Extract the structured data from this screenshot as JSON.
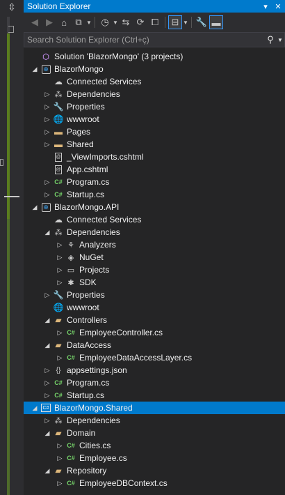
{
  "window": {
    "title": "Solution Explorer",
    "buttons": [
      "▾",
      "✕"
    ]
  },
  "toolbar": {
    "items": [
      {
        "icon": "back-icon",
        "glyph": "◀"
      },
      {
        "icon": "forward-icon",
        "glyph": "▶"
      },
      {
        "icon": "home-icon",
        "glyph": "⌂"
      },
      {
        "icon": "switch-views-icon",
        "glyph": "⧉"
      },
      {
        "icon": "pending-changes-icon",
        "glyph": "◷"
      },
      {
        "icon": "sync-icon",
        "glyph": "⇆"
      },
      {
        "icon": "refresh-icon",
        "glyph": "⟳"
      },
      {
        "icon": "collapse-all-icon",
        "glyph": "⧠"
      },
      {
        "icon": "show-all-files-icon",
        "glyph": "⊟"
      },
      {
        "icon": "properties-icon",
        "glyph": "🔧"
      },
      {
        "icon": "preview-icon",
        "glyph": "▬"
      }
    ]
  },
  "search": {
    "placeholder": "Search Solution Explorer (Ctrl+ç)",
    "value": ""
  },
  "tree": [
    {
      "label": "Solution 'BlazorMongo' (3 projects)",
      "icon": "solution-icon",
      "depth": 0,
      "expander": ""
    },
    {
      "label": "BlazorMongo",
      "icon": "web-project-icon",
      "depth": 0,
      "expander": "expanded"
    },
    {
      "label": "Connected Services",
      "icon": "cloud-icon",
      "depth": 1,
      "expander": ""
    },
    {
      "label": "Dependencies",
      "icon": "dependencies-icon",
      "depth": 1,
      "expander": "collapsed"
    },
    {
      "label": "Properties",
      "icon": "wrench-icon",
      "depth": 1,
      "expander": "collapsed"
    },
    {
      "label": "wwwroot",
      "icon": "globe-icon",
      "depth": 1,
      "expander": "collapsed"
    },
    {
      "label": "Pages",
      "icon": "folder-icon",
      "depth": 1,
      "expander": "collapsed"
    },
    {
      "label": "Shared",
      "icon": "folder-icon",
      "depth": 1,
      "expander": "collapsed"
    },
    {
      "label": "_ViewImports.cshtml",
      "icon": "razor-file-icon",
      "depth": 1,
      "expander": ""
    },
    {
      "label": "App.cshtml",
      "icon": "razor-file-icon",
      "depth": 1,
      "expander": ""
    },
    {
      "label": "Program.cs",
      "icon": "csharp-file-icon",
      "depth": 1,
      "expander": "collapsed"
    },
    {
      "label": "Startup.cs",
      "icon": "csharp-file-icon",
      "depth": 1,
      "expander": "collapsed"
    },
    {
      "label": "BlazorMongo.API",
      "icon": "web-project-icon",
      "depth": 0,
      "expander": "expanded"
    },
    {
      "label": "Connected Services",
      "icon": "cloud-icon",
      "depth": 1,
      "expander": ""
    },
    {
      "label": "Dependencies",
      "icon": "dependencies-icon",
      "depth": 1,
      "expander": "expanded"
    },
    {
      "label": "Analyzers",
      "icon": "analyzers-icon",
      "depth": 2,
      "expander": "collapsed"
    },
    {
      "label": "NuGet",
      "icon": "nuget-icon",
      "depth": 2,
      "expander": "collapsed"
    },
    {
      "label": "Projects",
      "icon": "projects-icon",
      "depth": 2,
      "expander": "collapsed"
    },
    {
      "label": "SDK",
      "icon": "sdk-icon",
      "depth": 2,
      "expander": "collapsed"
    },
    {
      "label": "Properties",
      "icon": "wrench-icon",
      "depth": 1,
      "expander": "collapsed"
    },
    {
      "label": "wwwroot",
      "icon": "globe-icon",
      "depth": 1,
      "expander": ""
    },
    {
      "label": "Controllers",
      "icon": "folder-open-icon",
      "depth": 1,
      "expander": "expanded"
    },
    {
      "label": "EmployeeController.cs",
      "icon": "csharp-file-icon",
      "depth": 2,
      "expander": "collapsed"
    },
    {
      "label": "DataAccess",
      "icon": "folder-open-icon",
      "depth": 1,
      "expander": "expanded"
    },
    {
      "label": "EmployeeDataAccessLayer.cs",
      "icon": "csharp-file-icon",
      "depth": 2,
      "expander": "collapsed"
    },
    {
      "label": "appsettings.json",
      "icon": "json-file-icon",
      "depth": 1,
      "expander": "collapsed"
    },
    {
      "label": "Program.cs",
      "icon": "csharp-file-icon",
      "depth": 1,
      "expander": "collapsed"
    },
    {
      "label": "Startup.cs",
      "icon": "csharp-file-icon",
      "depth": 1,
      "expander": "collapsed"
    },
    {
      "label": "BlazorMongo.Shared",
      "icon": "csharp-library-icon",
      "depth": 0,
      "expander": "expanded",
      "selected": true
    },
    {
      "label": "Dependencies",
      "icon": "dependencies-icon",
      "depth": 1,
      "expander": "collapsed"
    },
    {
      "label": "Domain",
      "icon": "folder-open-icon",
      "depth": 1,
      "expander": "expanded"
    },
    {
      "label": "Cities.cs",
      "icon": "csharp-file-icon",
      "depth": 2,
      "expander": "collapsed"
    },
    {
      "label": "Employee.cs",
      "icon": "csharp-file-icon",
      "depth": 2,
      "expander": "collapsed"
    },
    {
      "label": "Repository",
      "icon": "folder-open-icon",
      "depth": 1,
      "expander": "expanded"
    },
    {
      "label": "EmployeeDBContext.cs",
      "icon": "csharp-file-icon",
      "depth": 2,
      "expander": "collapsed"
    }
  ],
  "colors": {
    "accent": "#007acc",
    "background": "#252526",
    "folder": "#dcb67a",
    "csharp": "#77d66b"
  }
}
